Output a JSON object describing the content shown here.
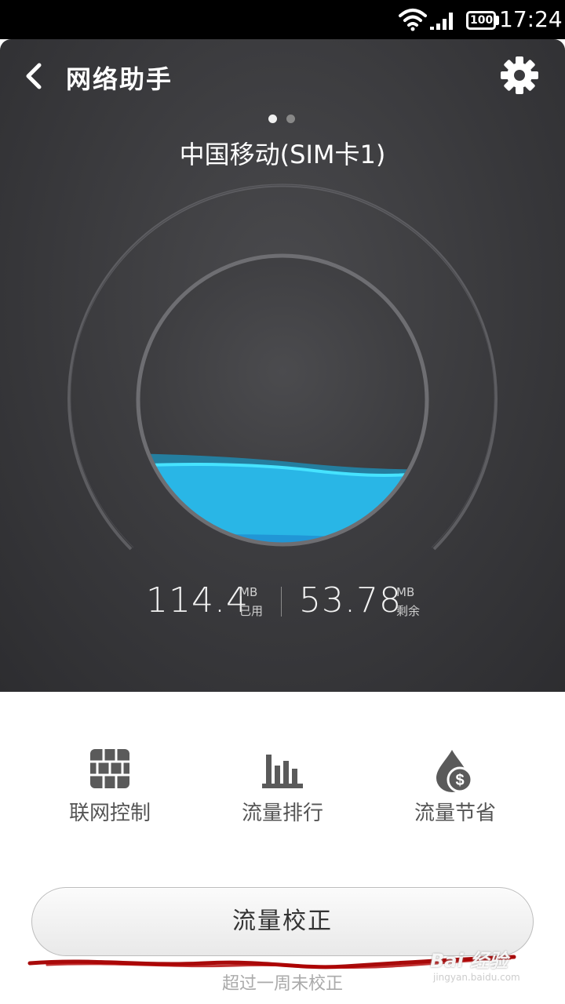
{
  "status_bar": {
    "time": "17:24",
    "battery": "100",
    "icons": [
      "wifi-icon",
      "signal-icon",
      "battery-icon"
    ]
  },
  "header": {
    "title": "网络助手",
    "back_icon": "chevron-left-icon",
    "settings_icon": "gear-icon"
  },
  "sim": {
    "name": "中国移动(SIM卡1)",
    "pages": 2,
    "active_page": 0
  },
  "gauge": {
    "used_fraction": 0.32,
    "colors": {
      "water": "#29b6e6",
      "water_highlight": "#3fe0ff",
      "ring": "#6e6e72"
    }
  },
  "usage": {
    "used_value": "114.4",
    "used_unit": "MB",
    "used_label": "已用",
    "remaining_value": "53.78",
    "remaining_unit": "MB",
    "remaining_label": "剩余"
  },
  "actions": [
    {
      "label": "联网控制",
      "icon": "firewall-icon"
    },
    {
      "label": "流量排行",
      "icon": "bar-chart-icon"
    },
    {
      "label": "流量节省",
      "icon": "money-drop-icon"
    }
  ],
  "calibrate": {
    "button_label": "流量校正",
    "hint": "超过一周未校正"
  },
  "watermark": {
    "main": "Bai 经验",
    "sub": "jingyan.baidu.com"
  },
  "colors": {
    "panel": "#3a3a3d",
    "annotation_stroke": "#b00000"
  }
}
